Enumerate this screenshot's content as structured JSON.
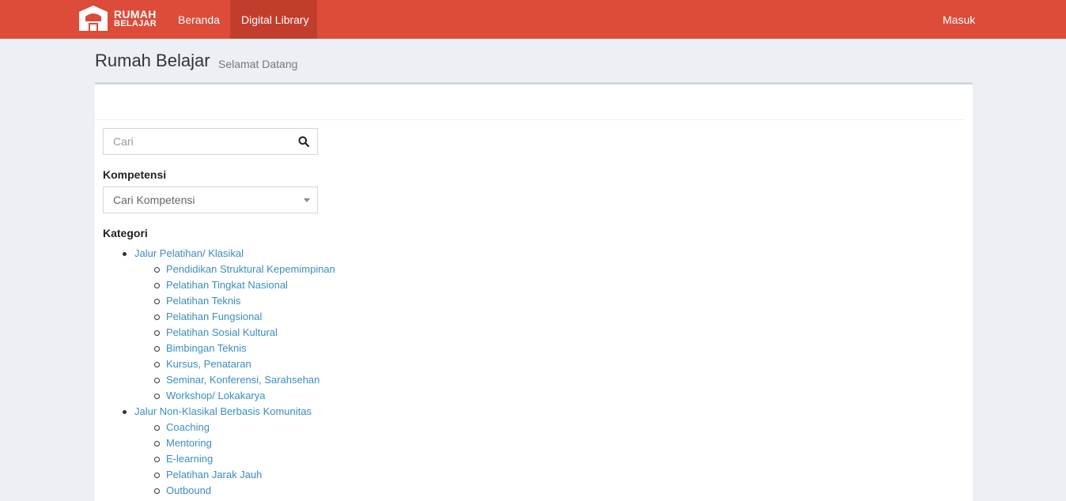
{
  "navbar": {
    "logo_line1": "RUMAH",
    "logo_line2": "BELAJAR",
    "items": [
      {
        "label": "Beranda"
      },
      {
        "label": "Digital Library"
      }
    ],
    "login_label": "Masuk"
  },
  "header": {
    "title": "Rumah Belajar",
    "subtitle": "Selamat Datang"
  },
  "search": {
    "placeholder": "Cari"
  },
  "kompetensi": {
    "label": "Kompetensi",
    "placeholder": "Cari Kompetensi"
  },
  "kategori": {
    "label": "Kategori",
    "groups": [
      {
        "label": "Jalur Pelatihan/ Klasikal",
        "items": [
          "Pendidikan Struktural Kepemimpinan",
          "Pelatihan Tingkat Nasional",
          "Pelatihan Teknis",
          "Pelatihan Fungsional",
          "Pelatihan Sosial Kultural",
          "Bimbingan Teknis",
          "Kursus, Penataran",
          "Seminar, Konferensi, Sarahsehan",
          "Workshop/ Lokakarya"
        ]
      },
      {
        "label": "Jalur Non-Klasikal Berbasis Komunitas",
        "items": [
          "Coaching",
          "Mentoring",
          "E-learning",
          "Pelatihan Jarak Jauh",
          "Outbound"
        ]
      }
    ]
  },
  "colors": {
    "navbar": "#dd4b39",
    "navbar_active": "#c23d2c",
    "link": "#3c8dbc",
    "page_bg": "#ecf0f5"
  }
}
